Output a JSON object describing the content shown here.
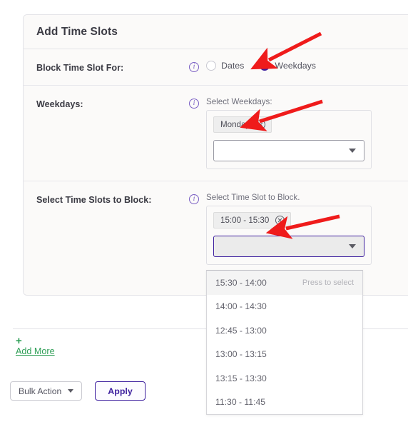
{
  "card": {
    "title": "Add Time Slots"
  },
  "rows": {
    "block_for": {
      "label": "Block Time Slot For:",
      "info_icon": "info-circle-icon",
      "options": [
        {
          "label": "Dates",
          "selected": false
        },
        {
          "label": "Weekdays",
          "selected": true
        }
      ]
    },
    "weekdays": {
      "label": "Weekdays:",
      "info_icon": "info-circle-icon",
      "caption": "Select Weekdays:",
      "chips": [
        {
          "label": "Monday",
          "remove_icon": "remove-circle-icon"
        }
      ],
      "select_value": "",
      "caret_icon": "chevron-down-icon"
    },
    "time_slots": {
      "label": "Select Time Slots to Block:",
      "info_icon": "info-circle-icon",
      "caption": "Select Time Slot to Block.",
      "chips": [
        {
          "label": "15:00 - 15:30",
          "remove_icon": "remove-circle-icon"
        }
      ],
      "select_value": "",
      "caret_icon": "chevron-down-icon"
    }
  },
  "dropdown": {
    "hint": "Press to select",
    "items": [
      {
        "label": "15:30 - 14:00",
        "active": true
      },
      {
        "label": "14:00 - 14:30",
        "active": false
      },
      {
        "label": "12:45 - 13:00",
        "active": false
      },
      {
        "label": "13:00 - 13:15",
        "active": false
      },
      {
        "label": "13:15 - 13:30",
        "active": false
      },
      {
        "label": "11:30 - 11:45",
        "active": false
      }
    ]
  },
  "footer": {
    "add_more_plus": "+",
    "add_more_label": "Add More",
    "bulk_action_label": "Bulk Action",
    "bulk_caret_icon": "chevron-down-icon",
    "apply_label": "Apply"
  },
  "annotations": {
    "arrow_color": "#ef1b1b",
    "arrows": [
      {
        "name": "arrow-to-weekdays-radio"
      },
      {
        "name": "arrow-to-monday-chip"
      },
      {
        "name": "arrow-to-time-slot-chip"
      }
    ]
  },
  "colors": {
    "accent_purple": "#3d1f9e",
    "link_green": "#2e9e56",
    "card_bg": "#fbfaf9",
    "border": "#e3e3e8"
  }
}
